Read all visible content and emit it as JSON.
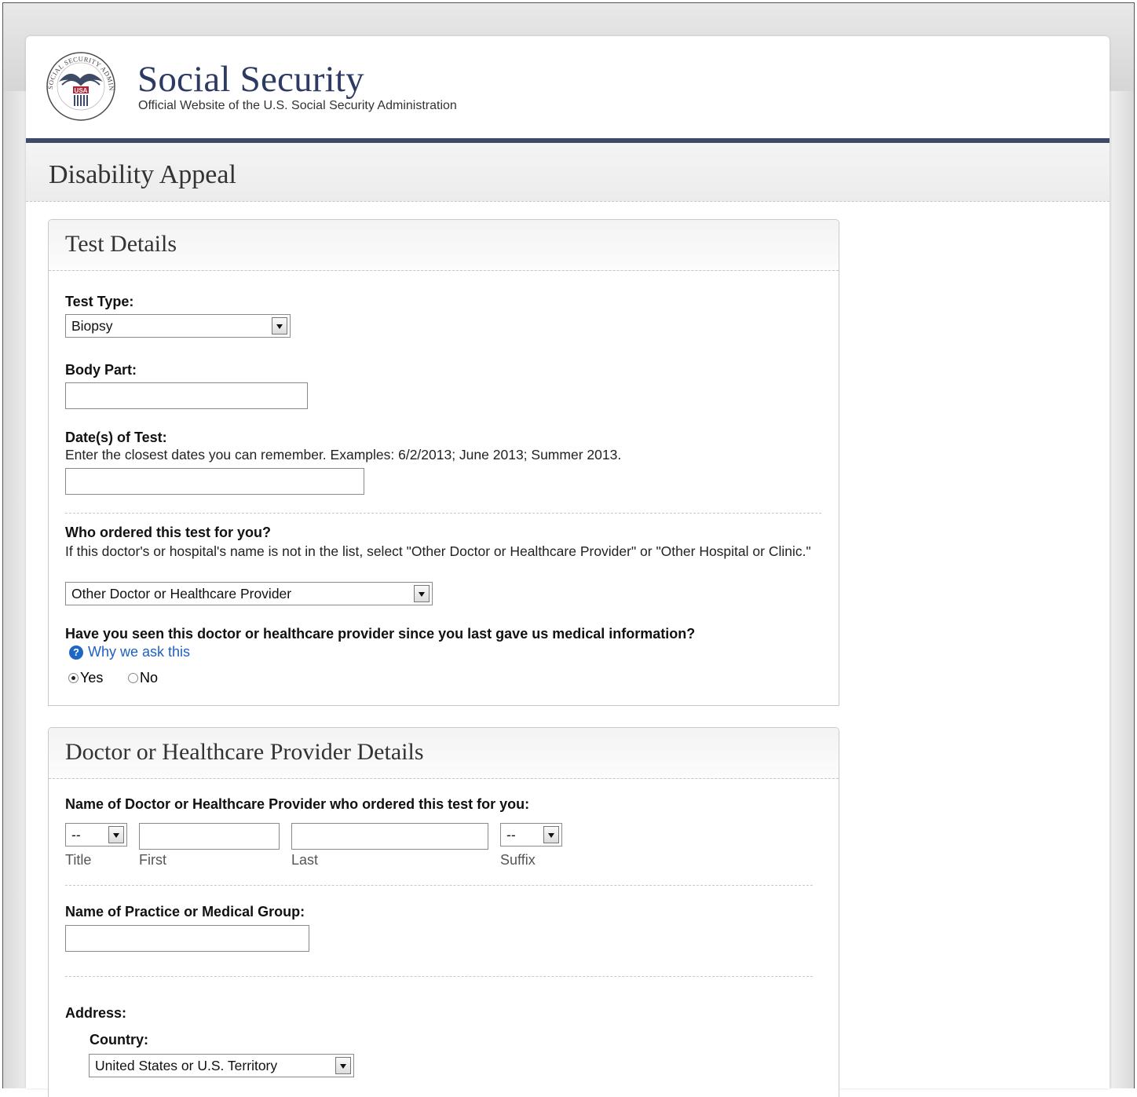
{
  "header": {
    "seal_text": "SOCIAL SECURITY ADMINISTRATION",
    "seal_usa": "USA",
    "title": "Social Security",
    "subtitle": "Official Website of the U.S. Social Security Administration"
  },
  "page_heading": "Disability Appeal",
  "test_details": {
    "title": "Test Details",
    "test_type_label": "Test Type:",
    "test_type_value": "Biopsy",
    "body_part_label": "Body Part:",
    "body_part_value": "",
    "dates_label": "Date(s) of Test:",
    "dates_hint": "Enter the closest dates you can remember. Examples: 6/2/2013; June 2013; Summer 2013.",
    "dates_value": "",
    "ordered_by_label": "Who ordered this test for you?",
    "ordered_by_hint": "If this doctor's or hospital's name is not in the list, select \"Other Doctor or Healthcare Provider\" or \"Other Hospital or Clinic.\"",
    "ordered_by_value": "Other Doctor or Healthcare Provider",
    "seen_label": "Have you seen this doctor or healthcare provider since you last gave us medical information?",
    "why_link": "Why we ask this",
    "yes_label": "Yes",
    "no_label": "No",
    "seen_selected": "Yes"
  },
  "provider_details": {
    "title": "Doctor or Healthcare Provider Details",
    "name_label": "Name of Doctor or Healthcare Provider who ordered this test for you:",
    "title_select_value": "--",
    "title_caption": "Title",
    "first_caption": "First",
    "last_caption": "Last",
    "suffix_select_value": "--",
    "suffix_caption": "Suffix",
    "practice_label": "Name of Practice or Medical Group:",
    "address_label": "Address:",
    "country_label": "Country:",
    "country_value": "United States or U.S. Territory"
  },
  "colors": {
    "brand_navy": "#2d3b63",
    "header_rule": "#3e4b66",
    "link_blue": "#1f5fc4"
  }
}
